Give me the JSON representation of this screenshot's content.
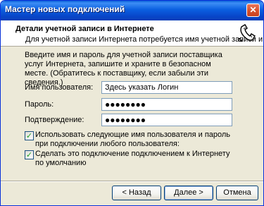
{
  "window": {
    "title": "Мастер новых подключений",
    "close_glyph": "✕"
  },
  "header": {
    "title": "Детали учетной записи в Интернете",
    "subtitle": "Для учетной записи Интернета потребуется имя учетной записи и пароль.",
    "icon": "phone-handset-icon"
  },
  "instructions": "Введите имя и пароль для учетной записи поставщика услуг Интернета, запишите и храните в безопасном месте. (Обратитесь к поставщику, если забыли эти сведения.)",
  "form": {
    "username_label": "Имя пользователя:",
    "username_value": "Здесь указать Логин",
    "password_label": "Пароль:",
    "password_value": "●●●●●●●●",
    "confirm_label": "Подтверждение:",
    "confirm_value": "●●●●●●●●"
  },
  "checkboxes": {
    "use_for_all_label": "Использовать следующие имя пользователя и пароль при подключении любого пользователя:",
    "use_for_all_checked": true,
    "default_connection_label": "Сделать это подключение подключением к Интернету по умолчанию",
    "default_connection_checked": true,
    "check_glyph": "✓"
  },
  "buttons": {
    "back": "< Назад",
    "next": "Далее >",
    "cancel": "Отмена"
  },
  "colors": {
    "titlebar": "#0b5fe0",
    "dialog_bg": "#ece9d8",
    "close_button": "#d9532e"
  }
}
